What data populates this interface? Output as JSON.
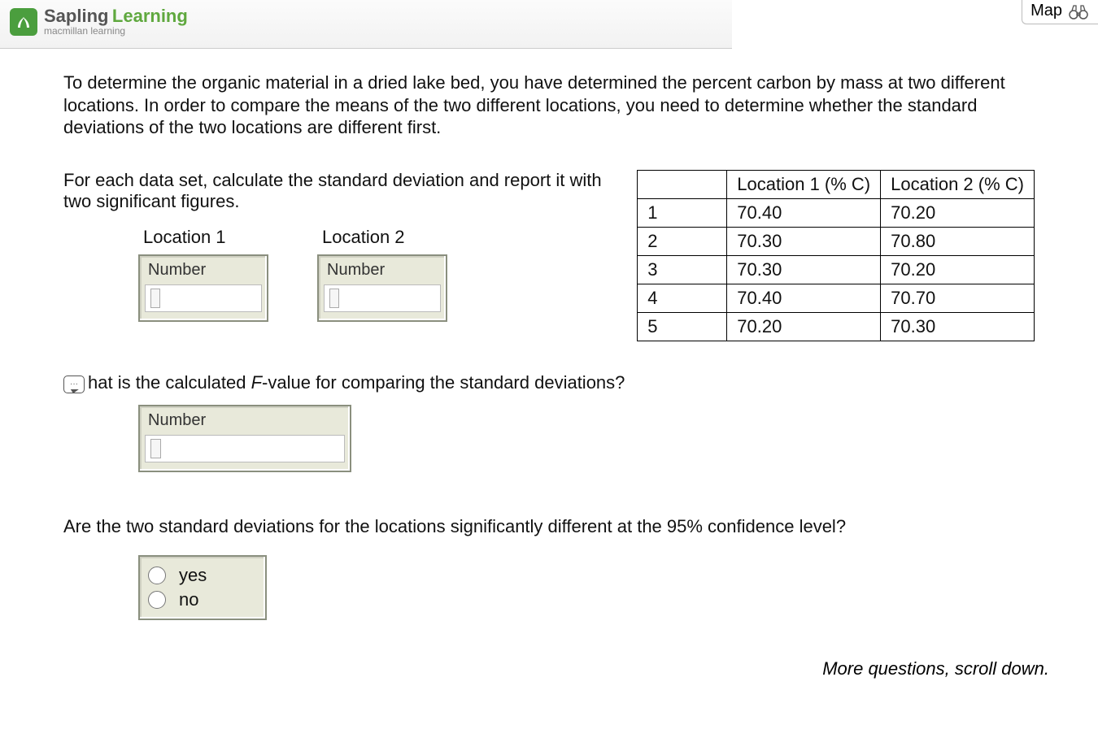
{
  "header": {
    "brand_sapling": "Sapling",
    "brand_learning": "Learning",
    "brand_sub": "macmillan learning",
    "map_label": "Map"
  },
  "prompt": "To determine the organic material in a dried lake bed, you have determined the percent carbon by mass at two different locations. In order to compare the means of the two different locations, you need to determine whether the standard deviations of the two locations are different first.",
  "instruction": "For each data set, calculate the standard deviation and report it with two significant figures.",
  "location_labels": {
    "loc1": "Location 1",
    "loc2": "Location 2"
  },
  "numbox_label": "Number",
  "table": {
    "headers": {
      "loc1": "Location 1 (% C)",
      "loc2": "Location 2 (% C)"
    },
    "rows": [
      {
        "n": "1",
        "l1": "70.40",
        "l2": "70.20"
      },
      {
        "n": "2",
        "l1": "70.30",
        "l2": "70.80"
      },
      {
        "n": "3",
        "l1": "70.30",
        "l2": "70.20"
      },
      {
        "n": "4",
        "l1": "70.40",
        "l2": "70.70"
      },
      {
        "n": "5",
        "l1": "70.20",
        "l2": "70.30"
      }
    ]
  },
  "q_fvalue_prefix": "hat is the calculated ",
  "q_fvalue_F": "F",
  "q_fvalue_suffix": "-value for comparing the standard deviations?",
  "q_significance": "Are the two standard deviations for the locations significantly different at the 95% confidence level?",
  "radio": {
    "yes": "yes",
    "no": "no"
  },
  "more": "More questions, scroll down.",
  "speech_dots": "···"
}
